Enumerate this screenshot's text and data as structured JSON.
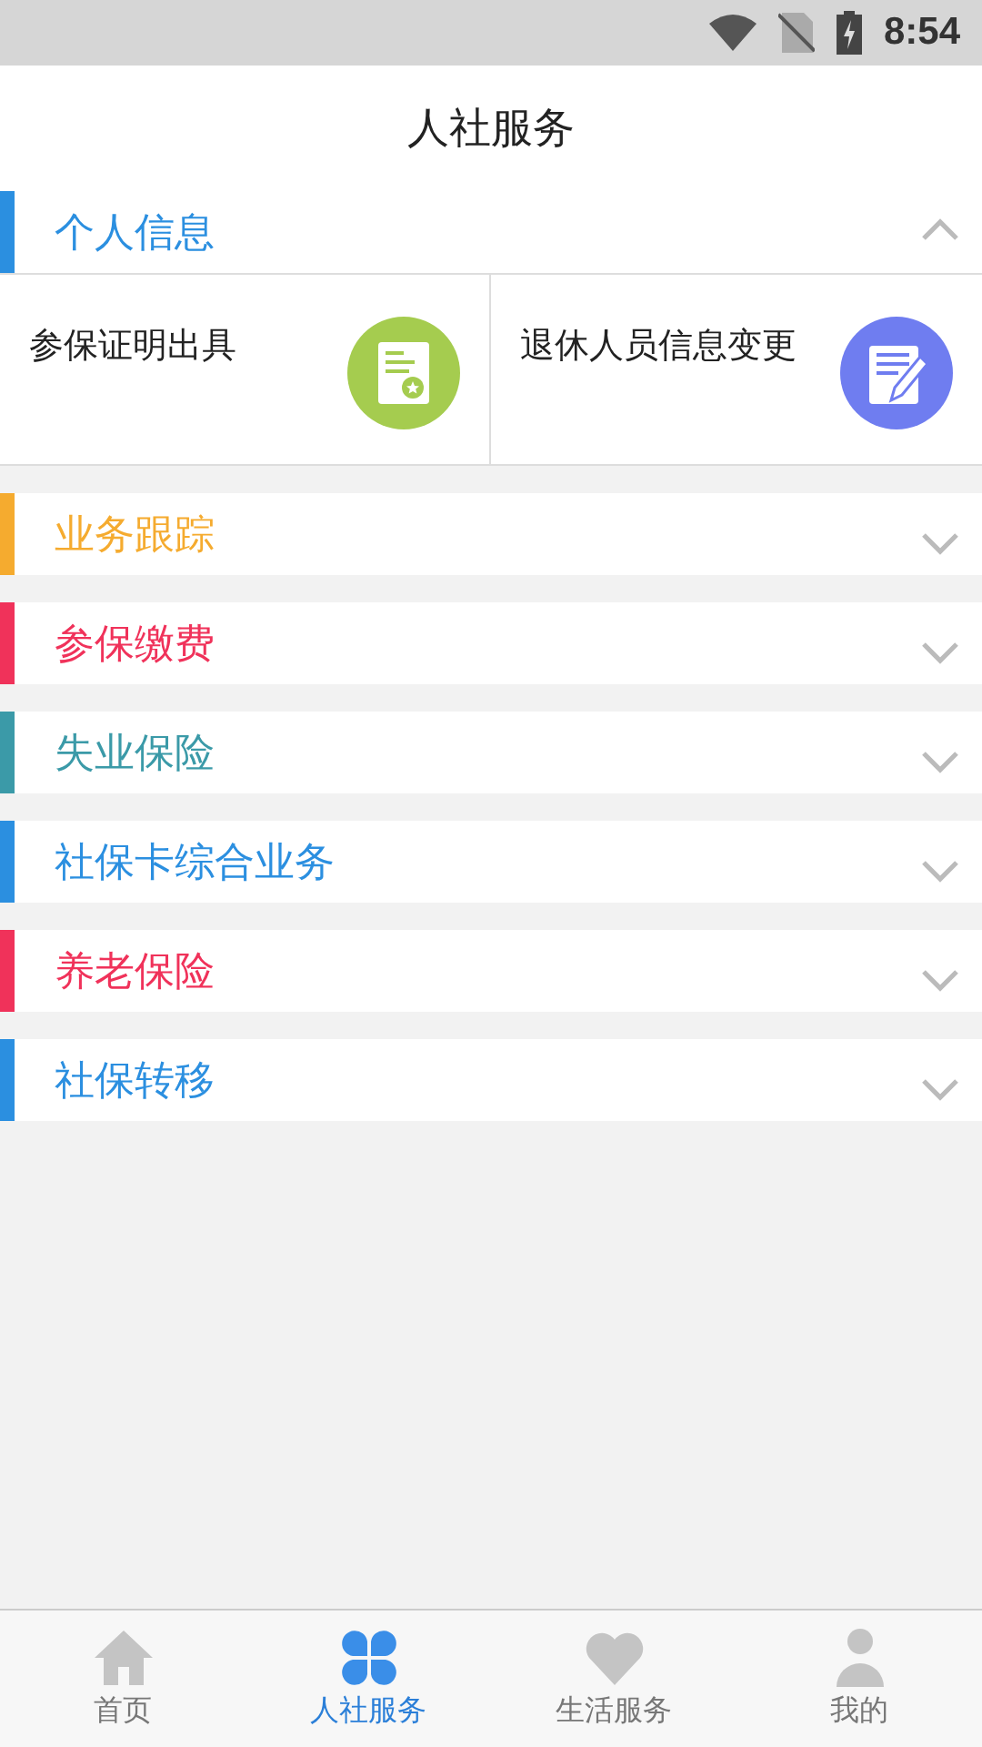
{
  "status_bar": {
    "time": "8:54"
  },
  "header": {
    "title": "人社服务"
  },
  "sections": [
    {
      "title": "个人信息",
      "color": "#2b8fe0",
      "expanded": true,
      "items": [
        {
          "label": "参保证明出具",
          "kind": "certificate",
          "color": "#a5cc4f"
        },
        {
          "label": "退休人员信息变更",
          "kind": "edit",
          "color": "#6f7df0"
        }
      ]
    },
    {
      "title": "业务跟踪",
      "color": "#f5ab2f",
      "expanded": false
    },
    {
      "title": "参保缴费",
      "color": "#f0325a",
      "expanded": false
    },
    {
      "title": "失业保险",
      "color": "#3b9aa8",
      "expanded": false
    },
    {
      "title": "社保卡综合业务",
      "color": "#2b8fe0",
      "expanded": false
    },
    {
      "title": "养老保险",
      "color": "#f0325a",
      "expanded": false
    },
    {
      "title": "社保转移",
      "color": "#2b8fe0",
      "expanded": false
    }
  ],
  "tabs": [
    {
      "label": "首页",
      "kind": "home",
      "selected": false
    },
    {
      "label": "人社服务",
      "kind": "clover",
      "selected": true
    },
    {
      "label": "生活服务",
      "kind": "heart",
      "selected": false
    },
    {
      "label": "我的",
      "kind": "person",
      "selected": false
    }
  ]
}
